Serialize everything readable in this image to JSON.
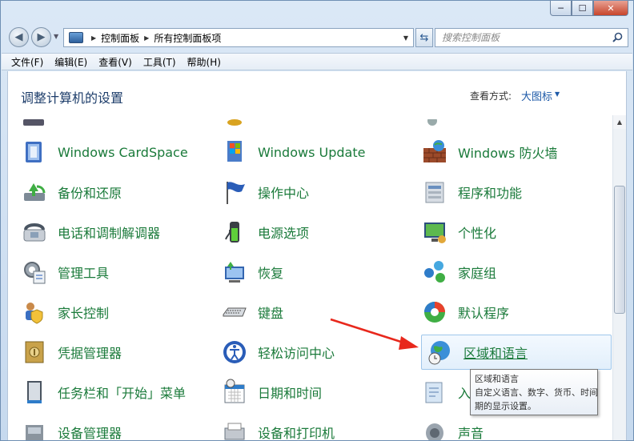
{
  "window": {
    "caption_min": "─",
    "caption_max": "☐",
    "caption_close": "✕"
  },
  "address": {
    "crumbs": [
      "控制面板",
      "所有控制面板项"
    ]
  },
  "search": {
    "placeholder": "搜索控制面板"
  },
  "menubar": [
    "文件(F)",
    "编辑(E)",
    "查看(V)",
    "工具(T)",
    "帮助(H)"
  ],
  "header": {
    "title": "调整计算机的设置",
    "view_label": "查看方式:",
    "view_value": "大图标"
  },
  "items": [
    [
      "Windows CardSpace",
      "Windows Update",
      "Windows 防火墙"
    ],
    [
      "备份和还原",
      "操作中心",
      "程序和功能"
    ],
    [
      "电话和调制解调器",
      "电源选项",
      "个性化"
    ],
    [
      "管理工具",
      "恢复",
      "家庭组"
    ],
    [
      "家长控制",
      "键盘",
      "默认程序"
    ],
    [
      "凭据管理器",
      "轻松访问中心",
      "区域和语言"
    ],
    [
      "任务栏和「开始」菜单",
      "日期和时间",
      "入"
    ],
    [
      "设备管理器",
      "设备和打印机",
      "声音"
    ]
  ],
  "tooltip": {
    "line1": "区域和语言",
    "line2": "自定义语言、数字、货币、时间和日",
    "line3": "期的显示设置。"
  },
  "colors": {
    "link_green": "#1a7a3a",
    "title_blue": "#1e3e6b",
    "arrow_red": "#e8281c"
  }
}
